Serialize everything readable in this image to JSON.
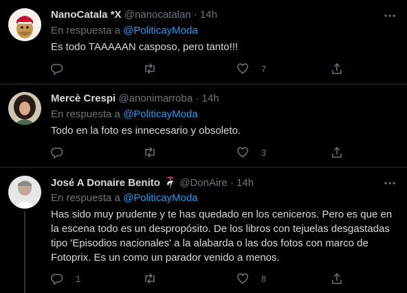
{
  "reply_prefix": "En respuesta a",
  "tweets": [
    {
      "name": "NanoCatala *X",
      "handle": "@nanocatalan",
      "time": "14h",
      "reply_to": "@PoliticayModa",
      "text": "Es todo TAAAAAN casposo, pero tanto!!!",
      "replies": "",
      "retweets": "",
      "likes": "7"
    },
    {
      "name": "Mercè Crespi",
      "handle": "@anonimarroba",
      "time": "14h",
      "reply_to": "@PoliticayModa",
      "text": "Todo en la foto es innecesario y obsoleto.",
      "replies": "",
      "retweets": "",
      "likes": "3"
    },
    {
      "name": "José A Donaire Benito",
      "name_emoji": "carousel-horse-icon",
      "handle": "@DonAire",
      "time": "14h",
      "reply_to": "@PoliticayModa",
      "text": "Has sido muy prudente y te has quedado en los ceniceros. Pero es que en la escena todo es un despropósito. De los libros con tejuelas desgastadas tipo 'Episodios nacionales' a la alabarda o las dos fotos con marco de Fotoprix. Es un como un parador venido a menos.",
      "replies": "1",
      "retweets": "",
      "likes": "8"
    }
  ],
  "colors": {
    "background": "#000000",
    "text": "#d9d9d9",
    "muted": "#6e767d",
    "link": "#1d9bf0",
    "divider": "#2f3336"
  }
}
